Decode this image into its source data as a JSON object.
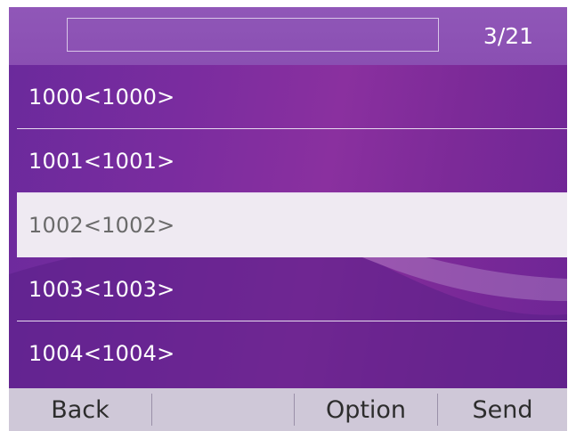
{
  "header": {
    "search_value": "",
    "page_counter": "3/21"
  },
  "contacts": [
    {
      "label": "1000<1000>",
      "selected": false
    },
    {
      "label": "1001<1001>",
      "selected": false
    },
    {
      "label": "1002<1002>",
      "selected": true
    },
    {
      "label": "1003<1003>",
      "selected": false
    },
    {
      "label": "1004<1004>",
      "selected": false
    }
  ],
  "softkeys": {
    "back": "Back",
    "empty": "",
    "option": "Option",
    "send": "Send"
  },
  "colors": {
    "background": "#7a2c9f",
    "topbar": "#8a4fb2",
    "selected_row": "#efeaf2",
    "softkey_bar": "#cfc8d8"
  }
}
